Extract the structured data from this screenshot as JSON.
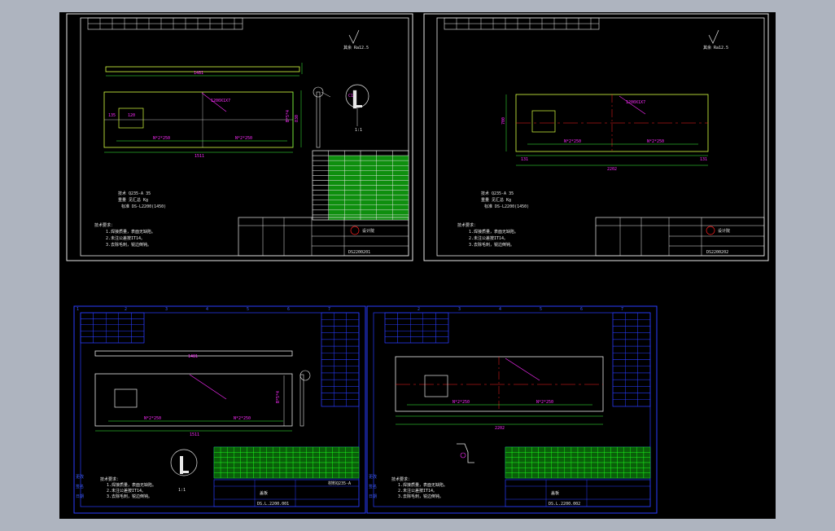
{
  "colors": {
    "background_outer": "#aeb4bf",
    "canvas": "#000000",
    "frame_white": "#e8e8e8",
    "frame_blue": "#2a3cff",
    "part_outline": "#d8ff40",
    "dimension": "#3cff3c",
    "center_line": "#ff2020",
    "annotation": "#ff2cff",
    "table_fill": "#1cff1c"
  },
  "sheets": {
    "top_left": {
      "length_label": "1481",
      "overall_label": "1511",
      "spacing_label": "N*2*250",
      "height_label": "B*5*4",
      "roughness_note": "其余 Ra12.5"
    },
    "top_right": {
      "overall_label": "2202",
      "spacing_label": "N*2*250",
      "roughness_note": "其余 Ra12.5"
    },
    "bottom_left": {
      "length_label": "1481",
      "overall_label": "1511",
      "spacing_label": "N*2*250",
      "drawing_no": "DS.L.2200.001"
    },
    "bottom_right": {
      "overall_label": "2202",
      "spacing_label": "N*2*250",
      "drawing_no": "DS.L.2200.002"
    }
  },
  "notes": {
    "title": "技术要求：",
    "line1": "1.焊接质量，表面无缺陷。",
    "line2": "2.未注公差按IT14。",
    "line3": "3.去除毛刺，锐边倒钝。"
  }
}
